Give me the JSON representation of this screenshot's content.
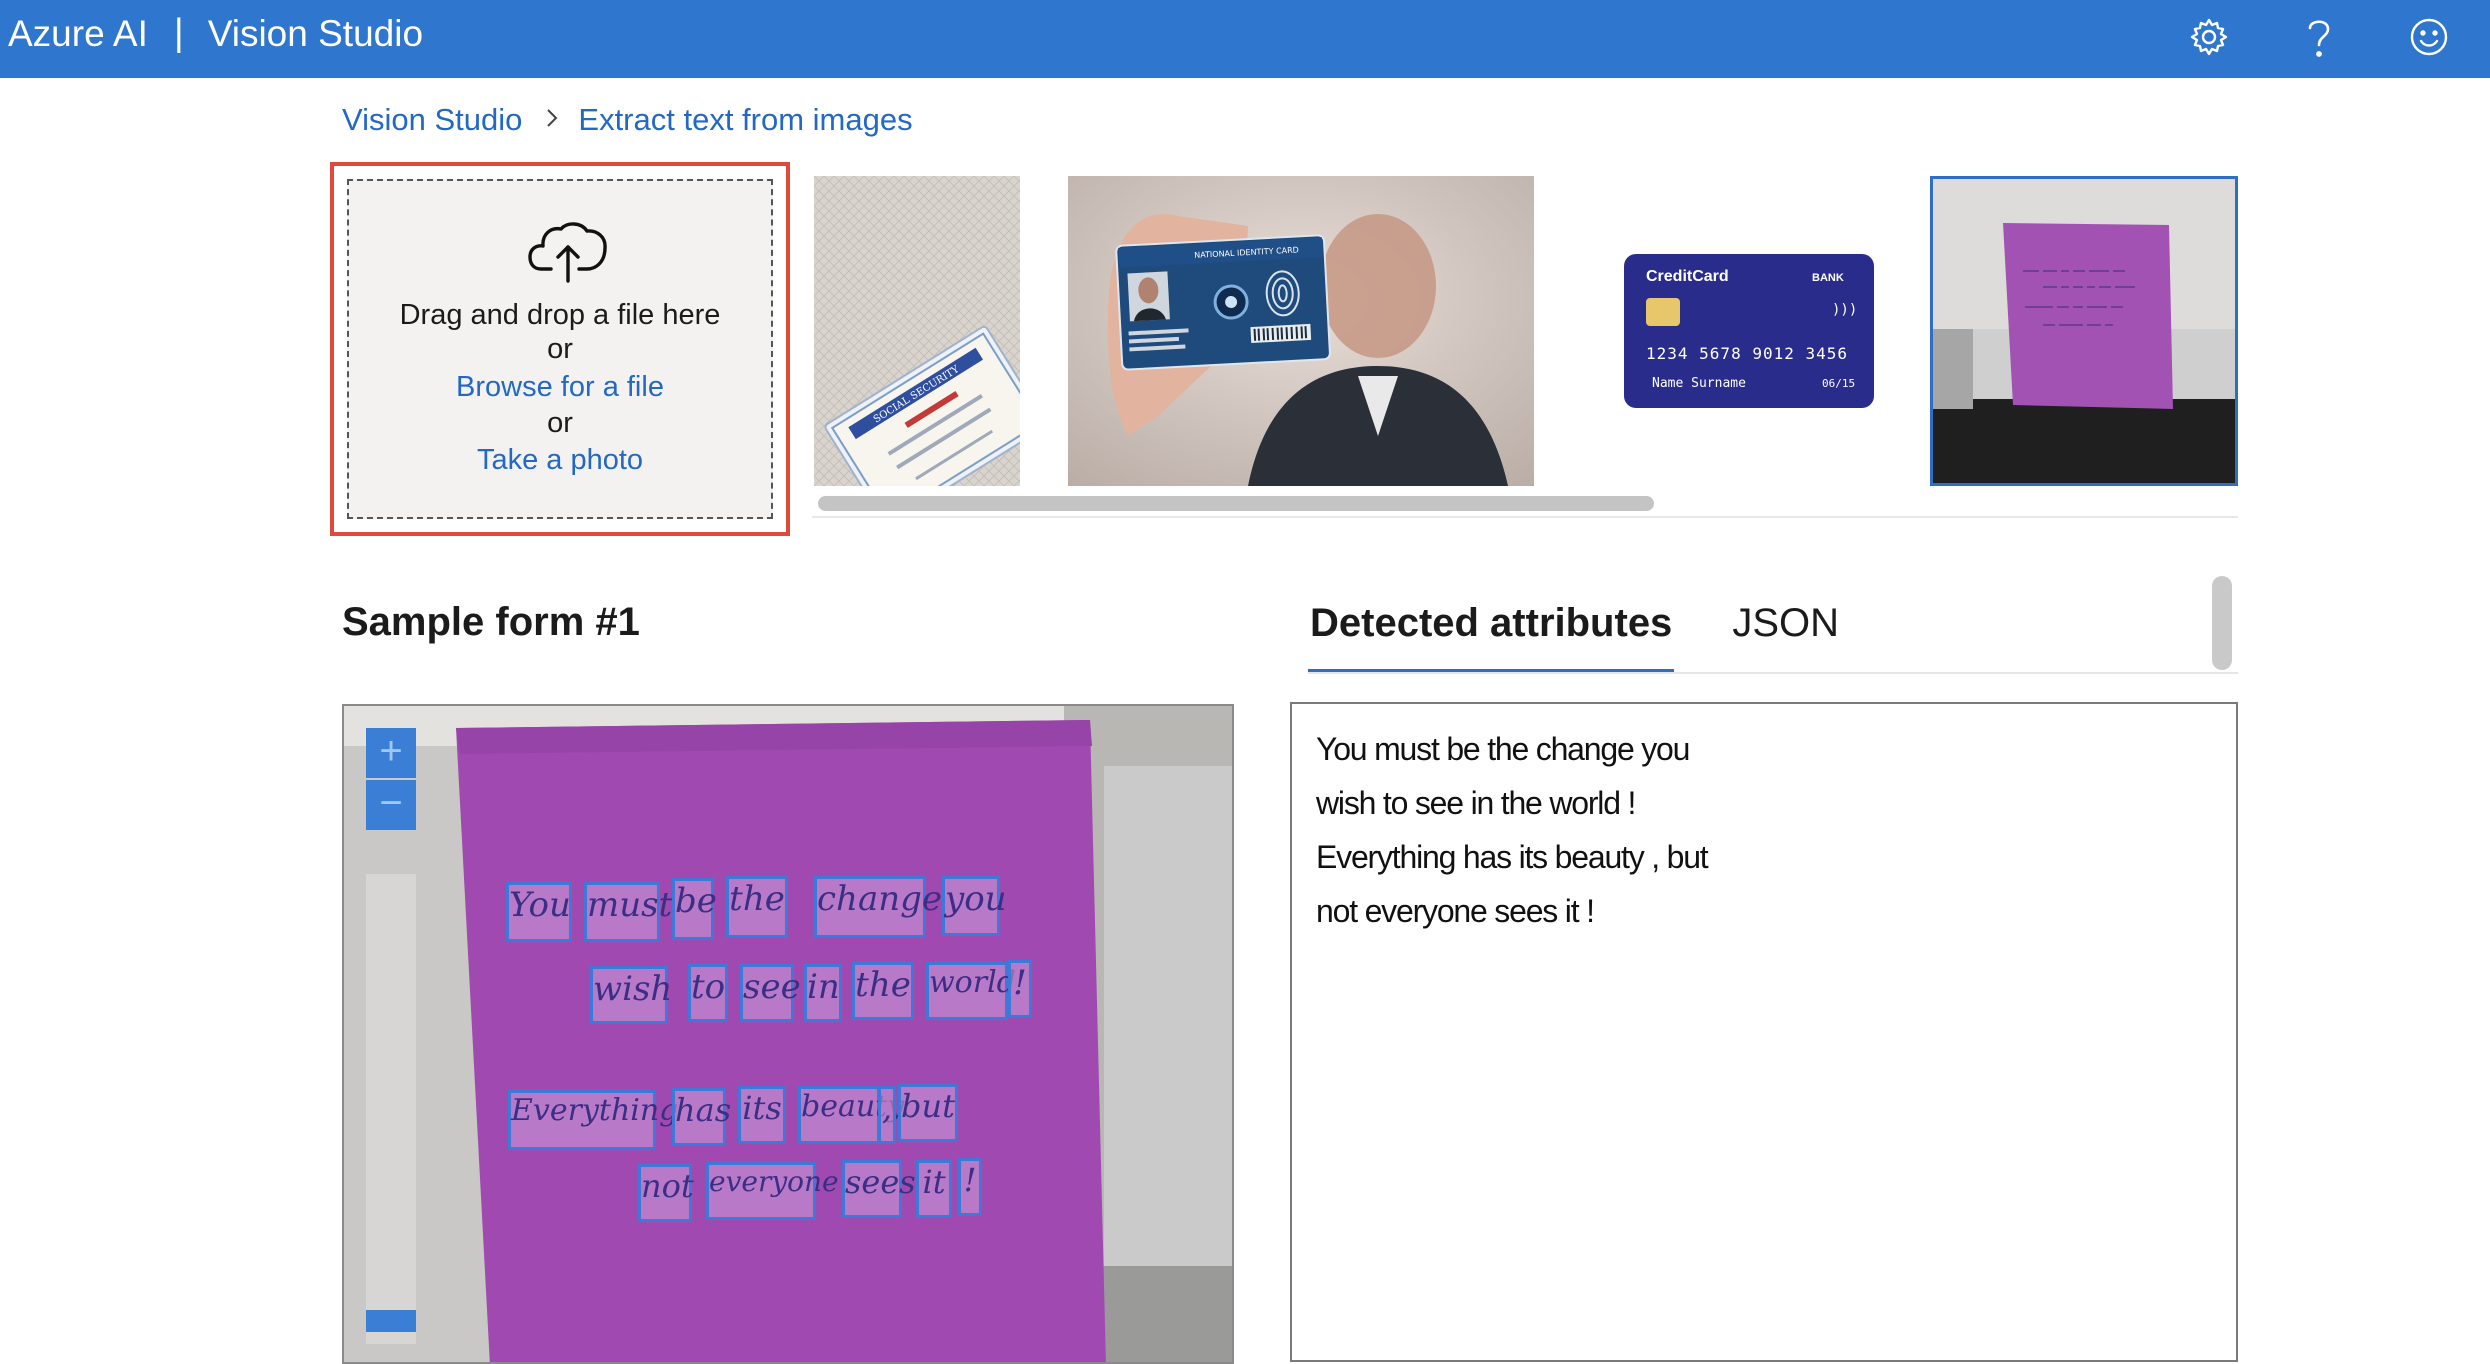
{
  "topbar": {
    "brand_left": "Azure AI",
    "brand_sep": "|",
    "brand_right": "Vision Studio",
    "icons": [
      "gear-icon",
      "help-icon",
      "feedback-smiley-icon"
    ]
  },
  "breadcrumb": {
    "home": "Vision Studio",
    "current": "Extract text from images"
  },
  "upload": {
    "drag_text": "Drag and drop a file here",
    "or1": "or",
    "browse_text": "Browse for a file",
    "or2": "or",
    "photo_text": "Take a photo"
  },
  "samples": {
    "credit_card": {
      "brand": "CreditCard",
      "bank": "BANK",
      "number": "1234 5678 9012 3456",
      "name": "Name Surname",
      "expiry": "06/15"
    },
    "id_card_title": "NATIONAL IDENTITY CARD",
    "ssn_text": "SOCIAL SECURITY"
  },
  "form": {
    "title": "Sample form #1"
  },
  "tabs": {
    "detected": "Detected attributes",
    "json": "JSON"
  },
  "viewer": {
    "zoom_in": "+",
    "zoom_out": "−",
    "note_words": [
      "You",
      "must",
      "be",
      "the",
      "change",
      "you",
      "wish",
      "to",
      "see",
      "in",
      "the",
      "world",
      "!",
      "Everything",
      "has",
      "its",
      "beauty",
      ",",
      "but",
      "not",
      "everyone",
      "sees",
      "it",
      "!"
    ]
  },
  "result": {
    "lines": [
      "You must be the change you",
      "wish to see in the world !",
      "Everything has its beauty , but",
      "not everyone sees it !"
    ]
  },
  "colors": {
    "header": "#2f77ce",
    "link": "#2369c4",
    "highlight_border": "#e04a3a",
    "note": "#9a4fae"
  }
}
